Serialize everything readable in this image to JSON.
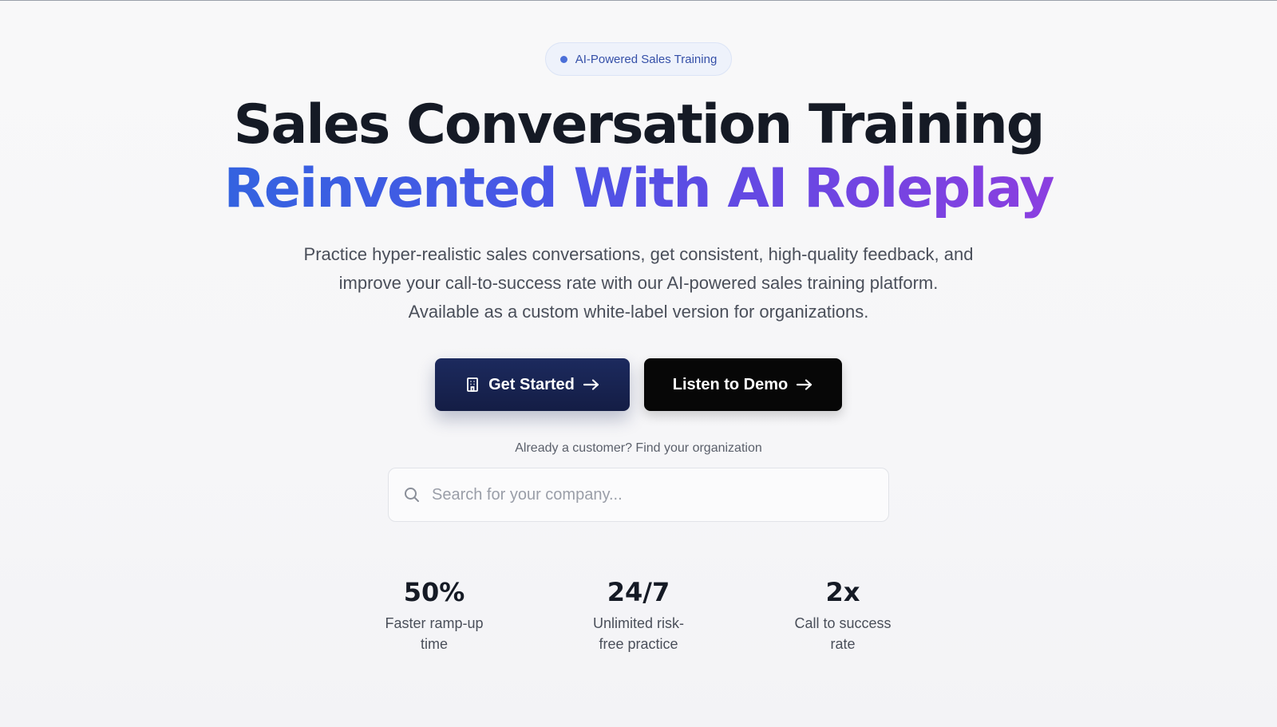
{
  "badge": {
    "label": "AI-Powered Sales Training"
  },
  "headline": {
    "line1": "Sales Conversation Training",
    "line2": "Reinvented With AI Roleplay"
  },
  "description": "Practice hyper-realistic sales conversations, get consistent, high-quality feedback, and improve your call-to-success rate with our AI-powered sales training platform. Available as a custom white-label version for organizations.",
  "cta": {
    "primary_label": "Get Started",
    "primary_icon": "building-icon",
    "secondary_label": "Listen to Demo",
    "arrow_icon": "arrow-right-icon"
  },
  "customer": {
    "note": "Already a customer? Find your organization",
    "search_placeholder": "Search for your company...",
    "search_value": ""
  },
  "stats": [
    {
      "value": "50%",
      "label": "Faster ramp-up time"
    },
    {
      "value": "24/7",
      "label": "Unlimited risk-free practice"
    },
    {
      "value": "2x",
      "label": "Call to success rate"
    }
  ],
  "colors": {
    "badge_text": "#3550a8",
    "gradient_start": "#3463e0",
    "gradient_end": "#8b3fe0",
    "primary_button": "#1c2a5e",
    "secondary_button": "#070707"
  }
}
